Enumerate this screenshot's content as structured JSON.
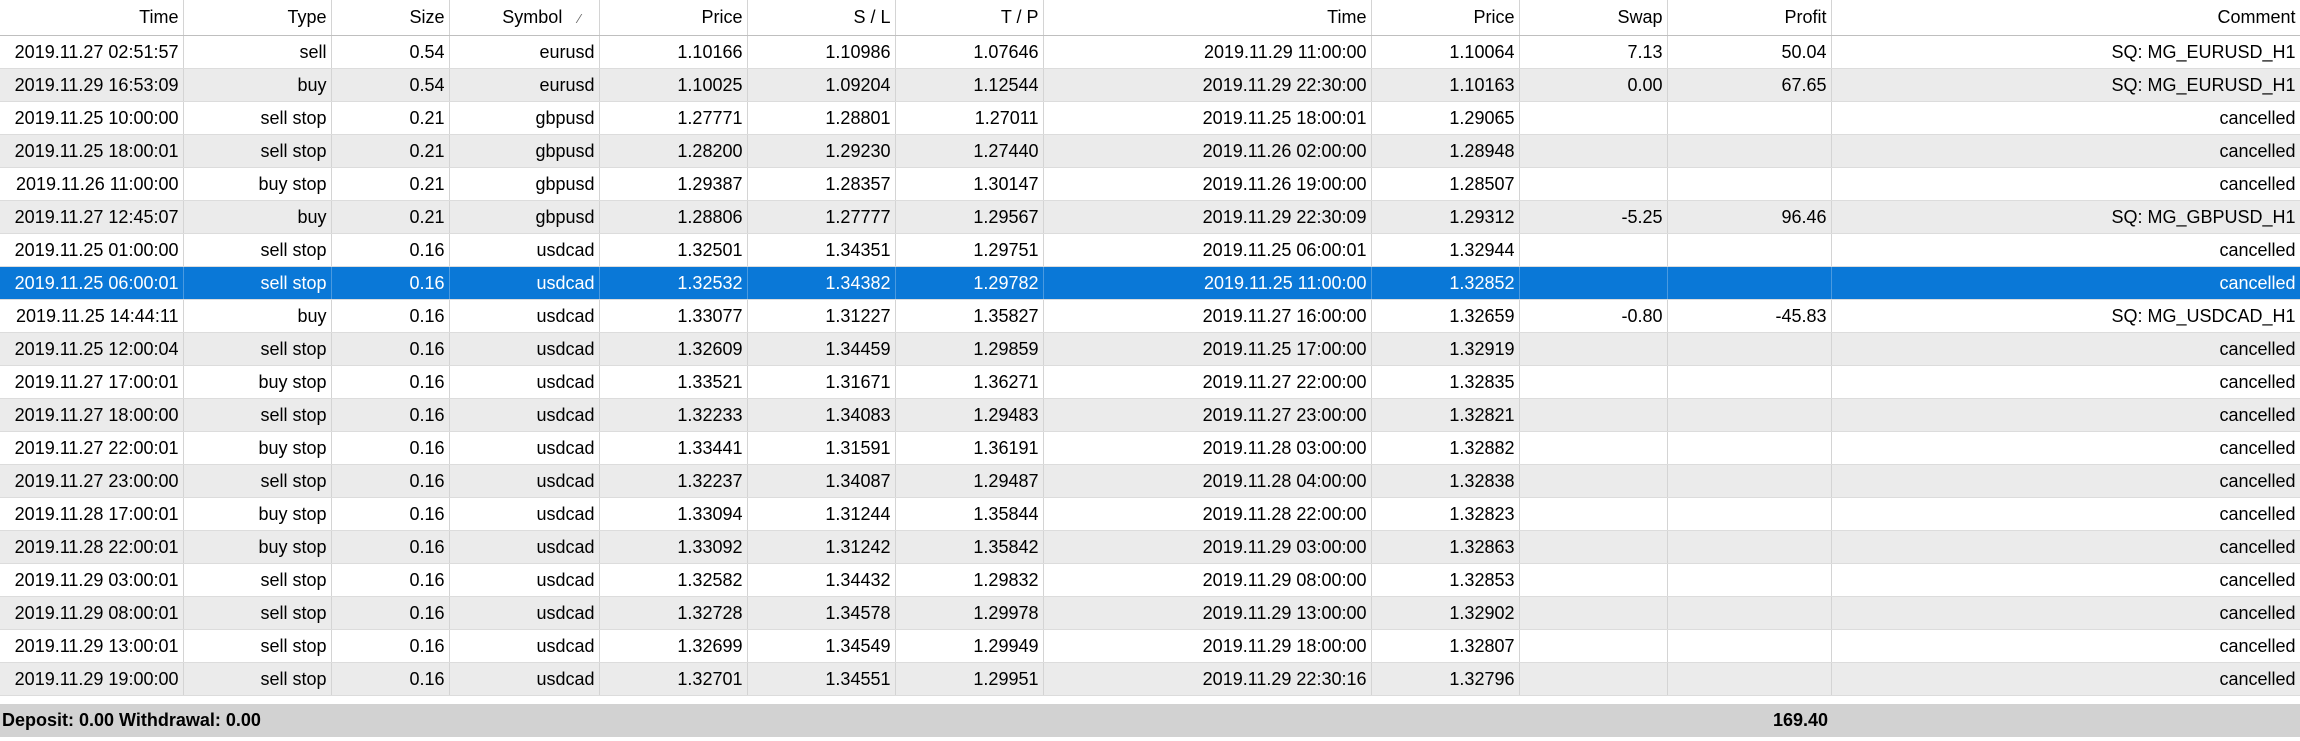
{
  "columns": [
    "Time",
    "Type",
    "Size",
    "Symbol",
    "Price",
    "S / L",
    "T / P",
    "Time",
    "Price",
    "Swap",
    "Profit",
    "Comment"
  ],
  "sort_indicator": "⁄",
  "rows": [
    [
      "2019.11.27 02:51:57",
      "sell",
      "0.54",
      "eurusd",
      "1.10166",
      "1.10986",
      "1.07646",
      "2019.11.29 11:00:00",
      "1.10064",
      "7.13",
      "50.04",
      "SQ: MG_EURUSD_H1"
    ],
    [
      "2019.11.29 16:53:09",
      "buy",
      "0.54",
      "eurusd",
      "1.10025",
      "1.09204",
      "1.12544",
      "2019.11.29 22:30:00",
      "1.10163",
      "0.00",
      "67.65",
      "SQ: MG_EURUSD_H1"
    ],
    [
      "2019.11.25 10:00:00",
      "sell stop",
      "0.21",
      "gbpusd",
      "1.27771",
      "1.28801",
      "1.27011",
      "2019.11.25 18:00:01",
      "1.29065",
      "",
      "",
      "cancelled"
    ],
    [
      "2019.11.25 18:00:01",
      "sell stop",
      "0.21",
      "gbpusd",
      "1.28200",
      "1.29230",
      "1.27440",
      "2019.11.26 02:00:00",
      "1.28948",
      "",
      "",
      "cancelled"
    ],
    [
      "2019.11.26 11:00:00",
      "buy stop",
      "0.21",
      "gbpusd",
      "1.29387",
      "1.28357",
      "1.30147",
      "2019.11.26 19:00:00",
      "1.28507",
      "",
      "",
      "cancelled"
    ],
    [
      "2019.11.27 12:45:07",
      "buy",
      "0.21",
      "gbpusd",
      "1.28806",
      "1.27777",
      "1.29567",
      "2019.11.29 22:30:09",
      "1.29312",
      "-5.25",
      "96.46",
      "SQ: MG_GBPUSD_H1"
    ],
    [
      "2019.11.25 01:00:00",
      "sell stop",
      "0.16",
      "usdcad",
      "1.32501",
      "1.34351",
      "1.29751",
      "2019.11.25 06:00:01",
      "1.32944",
      "",
      "",
      "cancelled"
    ],
    [
      "2019.11.25 06:00:01",
      "sell stop",
      "0.16",
      "usdcad",
      "1.32532",
      "1.34382",
      "1.29782",
      "2019.11.25 11:00:00",
      "1.32852",
      "",
      "",
      "cancelled"
    ],
    [
      "2019.11.25 14:44:11",
      "buy",
      "0.16",
      "usdcad",
      "1.33077",
      "1.31227",
      "1.35827",
      "2019.11.27 16:00:00",
      "1.32659",
      "-0.80",
      "-45.83",
      "SQ: MG_USDCAD_H1"
    ],
    [
      "2019.11.25 12:00:04",
      "sell stop",
      "0.16",
      "usdcad",
      "1.32609",
      "1.34459",
      "1.29859",
      "2019.11.25 17:00:00",
      "1.32919",
      "",
      "",
      "cancelled"
    ],
    [
      "2019.11.27 17:00:01",
      "buy stop",
      "0.16",
      "usdcad",
      "1.33521",
      "1.31671",
      "1.36271",
      "2019.11.27 22:00:00",
      "1.32835",
      "",
      "",
      "cancelled"
    ],
    [
      "2019.11.27 18:00:00",
      "sell stop",
      "0.16",
      "usdcad",
      "1.32233",
      "1.34083",
      "1.29483",
      "2019.11.27 23:00:00",
      "1.32821",
      "",
      "",
      "cancelled"
    ],
    [
      "2019.11.27 22:00:01",
      "buy stop",
      "0.16",
      "usdcad",
      "1.33441",
      "1.31591",
      "1.36191",
      "2019.11.28 03:00:00",
      "1.32882",
      "",
      "",
      "cancelled"
    ],
    [
      "2019.11.27 23:00:00",
      "sell stop",
      "0.16",
      "usdcad",
      "1.32237",
      "1.34087",
      "1.29487",
      "2019.11.28 04:00:00",
      "1.32838",
      "",
      "",
      "cancelled"
    ],
    [
      "2019.11.28 17:00:01",
      "buy stop",
      "0.16",
      "usdcad",
      "1.33094",
      "1.31244",
      "1.35844",
      "2019.11.28 22:00:00",
      "1.32823",
      "",
      "",
      "cancelled"
    ],
    [
      "2019.11.28 22:00:01",
      "buy stop",
      "0.16",
      "usdcad",
      "1.33092",
      "1.31242",
      "1.35842",
      "2019.11.29 03:00:00",
      "1.32863",
      "",
      "",
      "cancelled"
    ],
    [
      "2019.11.29 03:00:01",
      "sell stop",
      "0.16",
      "usdcad",
      "1.32582",
      "1.34432",
      "1.29832",
      "2019.11.29 08:00:00",
      "1.32853",
      "",
      "",
      "cancelled"
    ],
    [
      "2019.11.29 08:00:01",
      "sell stop",
      "0.16",
      "usdcad",
      "1.32728",
      "1.34578",
      "1.29978",
      "2019.11.29 13:00:00",
      "1.32902",
      "",
      "",
      "cancelled"
    ],
    [
      "2019.11.29 13:00:01",
      "sell stop",
      "0.16",
      "usdcad",
      "1.32699",
      "1.34549",
      "1.29949",
      "2019.11.29 18:00:00",
      "1.32807",
      "",
      "",
      "cancelled"
    ],
    [
      "2019.11.29 19:00:00",
      "sell stop",
      "0.16",
      "usdcad",
      "1.32701",
      "1.34551",
      "1.29951",
      "2019.11.29 22:30:16",
      "1.32796",
      "",
      "",
      "cancelled"
    ]
  ],
  "selected_row": 7,
  "footer": {
    "summary": "Deposit: 0.00  Withdrawal: 0.00",
    "total_profit": "169.40"
  },
  "colors": {
    "selection": "#0a78d7",
    "alt_row": "#ebebeb",
    "footer_bg": "#d2d2d2"
  }
}
